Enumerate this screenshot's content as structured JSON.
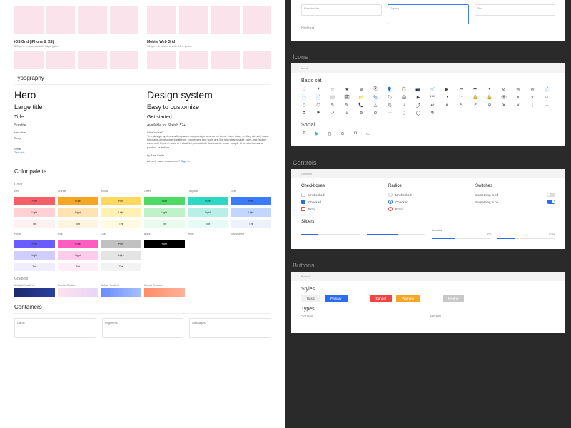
{
  "left": {
    "grids": [
      {
        "title": "iOS Grid (iPhone 8, XS)",
        "sub": "375px – 4 columns with 16px gutter"
      },
      {
        "title": "Mobile Web Grid",
        "sub": "320px – 4 columns with 20px gutter"
      }
    ],
    "typography": {
      "heading": "Typography",
      "hero": "Hero",
      "hero_r": "Design system",
      "large": "Large title",
      "large_r": "Easy to customize",
      "title": "Title",
      "title_r": "Get started",
      "sub": "Subtitle",
      "sub_r": "Available for Sketch 52+",
      "headline": "Headline",
      "headline_r": "What's next?",
      "body": "Body",
      "body_r": "Yes, design systems will replace many design jobs as we know them today — they already have. Interface development patterns, processes and tools are like interchangeable parts and factory assembly lines — tools of industrial productivity that enable fewer people to create the same product as before.",
      "small": "Small",
      "small_r": "by Alex Smith",
      "link": "Text link",
      "link_r_pre": "Already have an account? ",
      "link_r": "Sign In"
    },
    "palette": {
      "heading": "Color palette",
      "section_color": "Color",
      "section_gradient": "Gradient",
      "shades": [
        "Pure",
        "Light",
        "Tint"
      ],
      "row1": [
        {
          "name": "Red",
          "pure": "#f85e6a",
          "light": "#ffd0d4",
          "tint": "#fff0f1"
        },
        {
          "name": "Orange",
          "pure": "#f5a623",
          "light": "#ffe3b3",
          "tint": "#fff4e0"
        },
        {
          "name": "Yellow",
          "pure": "#ffd85e",
          "light": "#fff0b3",
          "tint": "#fffae0"
        },
        {
          "name": "Green",
          "pure": "#4cd964",
          "light": "#c0f2c9",
          "tint": "#e8fbec"
        },
        {
          "name": "Turquoise",
          "pure": "#2ed9c3",
          "light": "#b8f0e8",
          "tint": "#e6faf6"
        },
        {
          "name": "Blue",
          "pure": "#3a7bff",
          "light": "#c2d6ff",
          "tint": "#ebf1ff"
        }
      ],
      "row2": [
        {
          "name": "Purple",
          "pure": "#6a5cff",
          "light": "#d2ccff",
          "tint": "#efedff"
        },
        {
          "name": "Pink",
          "pure": "#ff5cc0",
          "light": "#ffccec",
          "tint": "#ffeef8"
        },
        {
          "name": "Gray",
          "pure": "#c1c1c1",
          "light": "#e4e4e4",
          "tint": "#f3f3f3"
        },
        {
          "name": "Black",
          "pure": "#000000",
          "light": "",
          "tint": ""
        },
        {
          "name": "White",
          "pure": "",
          "light": "",
          "tint": ""
        },
        {
          "name": "Transparent",
          "pure": "",
          "light": "",
          "tint": ""
        }
      ],
      "gradients": [
        {
          "name": "Midnight Gradient"
        },
        {
          "name": "Sunrise Gradient"
        },
        {
          "name": "Midday Gradient"
        },
        {
          "name": "Sunset Gradient"
        }
      ]
    },
    "containers": {
      "heading": "Containers",
      "items": [
        "Cards",
        "Segments",
        "Messages"
      ]
    }
  },
  "right": {
    "inputs": {
      "placeholder": "Placeholder",
      "typing": "Typing",
      "text": "Text",
      "hint": "Hint text"
    },
    "icons": {
      "heading": "Icons",
      "tab": "Icons",
      "basic": "Basic set",
      "social": "Social",
      "glyphs": [
        "♡",
        "♥",
        "☆",
        "★",
        "⊕",
        "⎘",
        "👤",
        "📋",
        "📷",
        "🛒",
        "▶",
        "⏯",
        "⏭",
        "◐",
        "⊘",
        "✉",
        "✉",
        "📄",
        "📄",
        "📄",
        "📰",
        "🗓",
        "📁",
        "📎",
        "🏷",
        "🖨",
        "▶",
        "⏮",
        "◑",
        "◔",
        "🔒",
        "🔓",
        "👁",
        "∧",
        "∨",
        "⌂",
        "◇",
        "⬡",
        "✎",
        "✎",
        "📞",
        "△",
        "🎙",
        "↓",
        "⤴",
        "↩",
        "∧",
        "<",
        ">",
        "⊘",
        "✕",
        "∨",
        "⋮",
        "…",
        "♻",
        "⚑",
        "↗",
        "⤓",
        "⊕",
        "⊖",
        "⋯",
        "⟨⟩",
        "◯",
        "↻"
      ],
      "social_glyphs": [
        "f",
        "🐦",
        "◻",
        "⊙",
        "in",
        "▭"
      ]
    },
    "controls": {
      "heading": "Controls",
      "tab": "Controls",
      "checkboxes": {
        "h": "Checkboxes",
        "items": [
          "Unchecked",
          "Checked",
          "Error"
        ]
      },
      "radios": {
        "h": "Radios",
        "items": [
          "Unchecked",
          "Checked",
          "Error"
        ]
      },
      "switches": {
        "h": "Switches",
        "off": "Something is off",
        "on": "Something is on"
      },
      "sliders": {
        "h": "Sliders",
        "labeled": "Labeled",
        "v1": "$20",
        "v2": "$259"
      }
    },
    "buttons": {
      "heading": "Buttons",
      "tab": "Buttons",
      "styles_h": "Styles",
      "types_h": "Types",
      "square": "Square",
      "round": "Round",
      "labels": {
        "basic": "Basic",
        "primary": "Primary",
        "danger": "Danger",
        "warning": "Warning",
        "neutral": "Neutral"
      }
    }
  }
}
